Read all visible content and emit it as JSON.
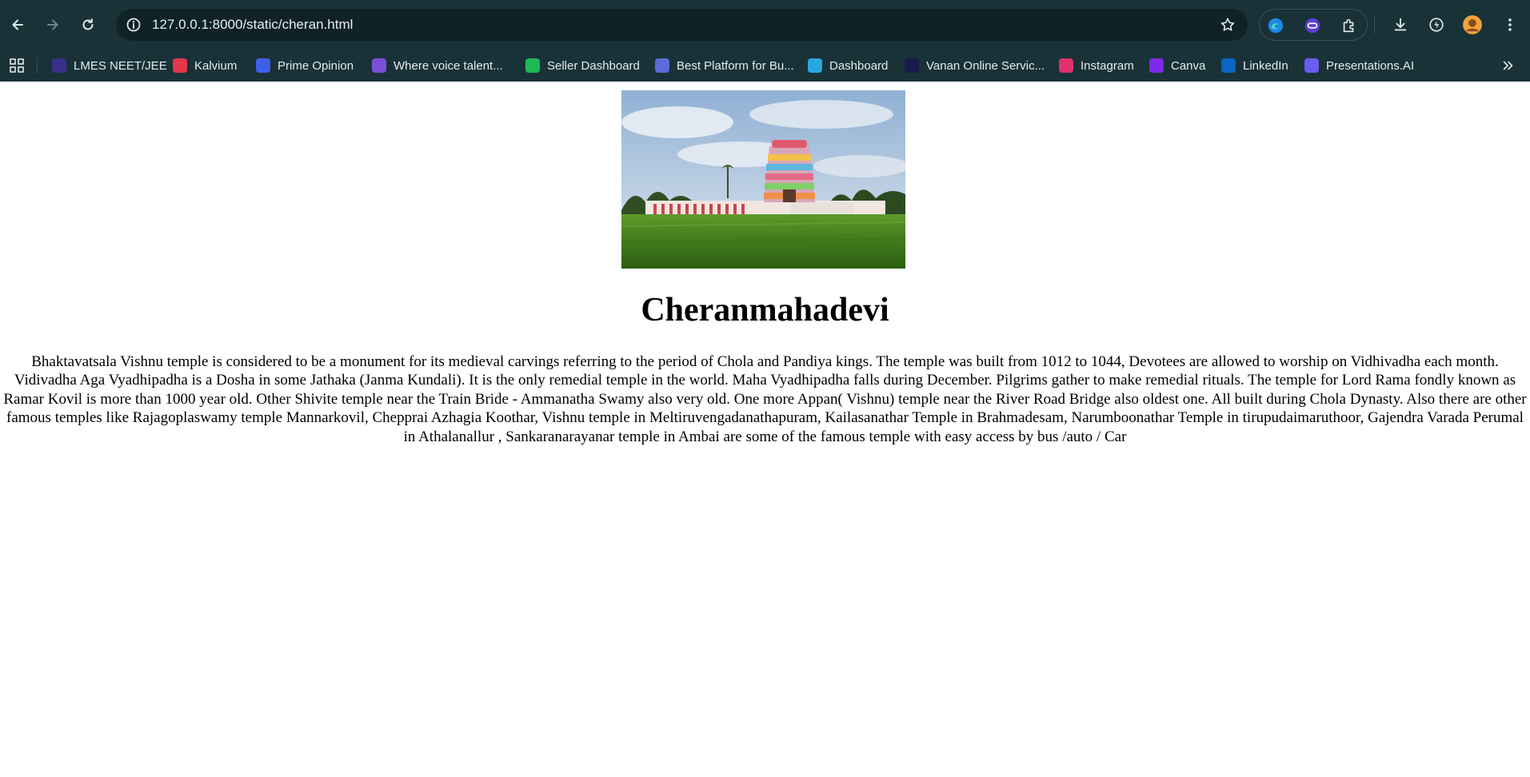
{
  "browser": {
    "url": "127.0.0.1:8000/static/cheran.html",
    "bookmarks": [
      {
        "label": "LMES NEET/JEE",
        "icon": "lmes-icon",
        "color": "#3a2f8a"
      },
      {
        "label": "Kalvium",
        "icon": "kalvium-icon",
        "color": "#e5364b"
      },
      {
        "label": "Prime Opinion",
        "icon": "prime-opinion-icon",
        "color": "#3f5fe8"
      },
      {
        "label": "Where voice talent...",
        "icon": "voice-talent-icon",
        "color": "#7b4fd6"
      },
      {
        "label": "Seller Dashboard",
        "icon": "seller-dashboard-icon",
        "color": "#1db954"
      },
      {
        "label": "Best Platform for Bu...",
        "icon": "best-platform-icon",
        "color": "#5a6ad8"
      },
      {
        "label": "Dashboard",
        "icon": "dashboard-icon",
        "color": "#2aa7e0"
      },
      {
        "label": "Vanan Online Servic...",
        "icon": "vanan-icon",
        "color": "#1a1a4a"
      },
      {
        "label": "Instagram",
        "icon": "instagram-icon",
        "color": "#e1306c"
      },
      {
        "label": "Canva",
        "icon": "canva-icon",
        "color": "#7d2ae8"
      },
      {
        "label": "LinkedIn",
        "icon": "linkedin-icon",
        "color": "#0a66c2"
      },
      {
        "label": "Presentations.AI",
        "icon": "presentations-ai-icon",
        "color": "#6b5cf0"
      }
    ]
  },
  "page": {
    "title": "Cheranmahadevi",
    "body": "Bhaktavatsala Vishnu temple is considered to be a monument for its medieval carvings referring to the period of Chola and Pandiya kings. The temple was built from 1012 to 1044, Devotees are allowed to worship on Vidhivadha each month. Vidivadha Aga Vyadhipadha is a Dosha in some Jathaka (Janma Kundali). It is the only remedial temple in the world. Maha Vyadhipadha falls during December. Pilgrims gather to make remedial rituals. The temple for Lord Rama fondly known as Ramar Kovil is more than 1000 year old. Other Shivite temple near the Train Bride - Ammanatha Swamy also very old. One more Appan( Vishnu) temple near the River Road Bridge also oldest one. All built during Chola Dynasty. Also there are other famous temples like Rajagoplaswamy temple Mannarkovil, Chepprai Azhagia Koothar, Vishnu temple in Meltiruvengadanathapuram, Kailasanathar Temple in Brahmadesam, Narumboonathar Temple in tirupudaimaruthoor, Gajendra Varada Perumal in Athalanallur , Sankaranarayanar temple in Ambai are some of the famous temple with easy access by bus /auto / Car"
  }
}
